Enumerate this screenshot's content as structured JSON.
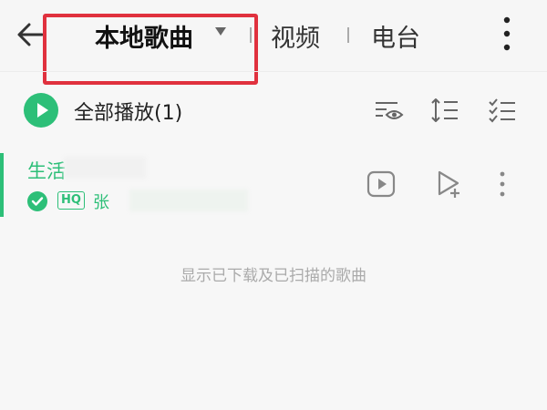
{
  "header": {
    "tabs": [
      {
        "label": "本地歌曲",
        "active": true
      },
      {
        "label": "视频",
        "active": false
      },
      {
        "label": "电台",
        "active": false
      }
    ]
  },
  "toolbar": {
    "play_all_label": "全部播放(1)",
    "icons": [
      "visibility-filter-icon",
      "sort-icon",
      "multi-select-icon"
    ]
  },
  "songs": [
    {
      "title": "生活",
      "title_tail": "",
      "quality_badge": "HQ",
      "artist": "张",
      "artist_tail": "",
      "downloaded": true
    }
  ],
  "empty_hint": "显示已下载及已扫描的歌曲",
  "colors": {
    "accent": "#2dbf78",
    "highlight": "#e0313e"
  }
}
